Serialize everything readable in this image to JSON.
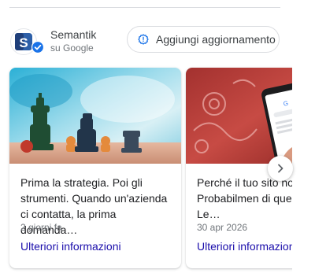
{
  "business": {
    "name": "Semantik",
    "source": "su Google",
    "logo_letter": "S"
  },
  "update_button": {
    "label": "Aggiungi aggiornamento",
    "icon": "update-icon"
  },
  "posts": [
    {
      "text": "Prima la strategia. Poi gli strumenti. Quando un'azienda ci contatta, la prima domanda…",
      "date": "2 giorni fa",
      "link": "Ulteriori informazioni",
      "image": "chess-pieces-photo"
    },
    {
      "text": "Perché il tuo sito non Google? Probabilmen di questi motivi. • Le…",
      "date": "30 apr 2026",
      "link": "Ulteriori informazioni",
      "image": "phone-google-search-photo"
    }
  ],
  "next_arrow": {
    "icon": "chevron-right-icon"
  },
  "colors": {
    "link": "#1a0dab",
    "accent": "#1a73e8",
    "border": "#dadce0"
  }
}
